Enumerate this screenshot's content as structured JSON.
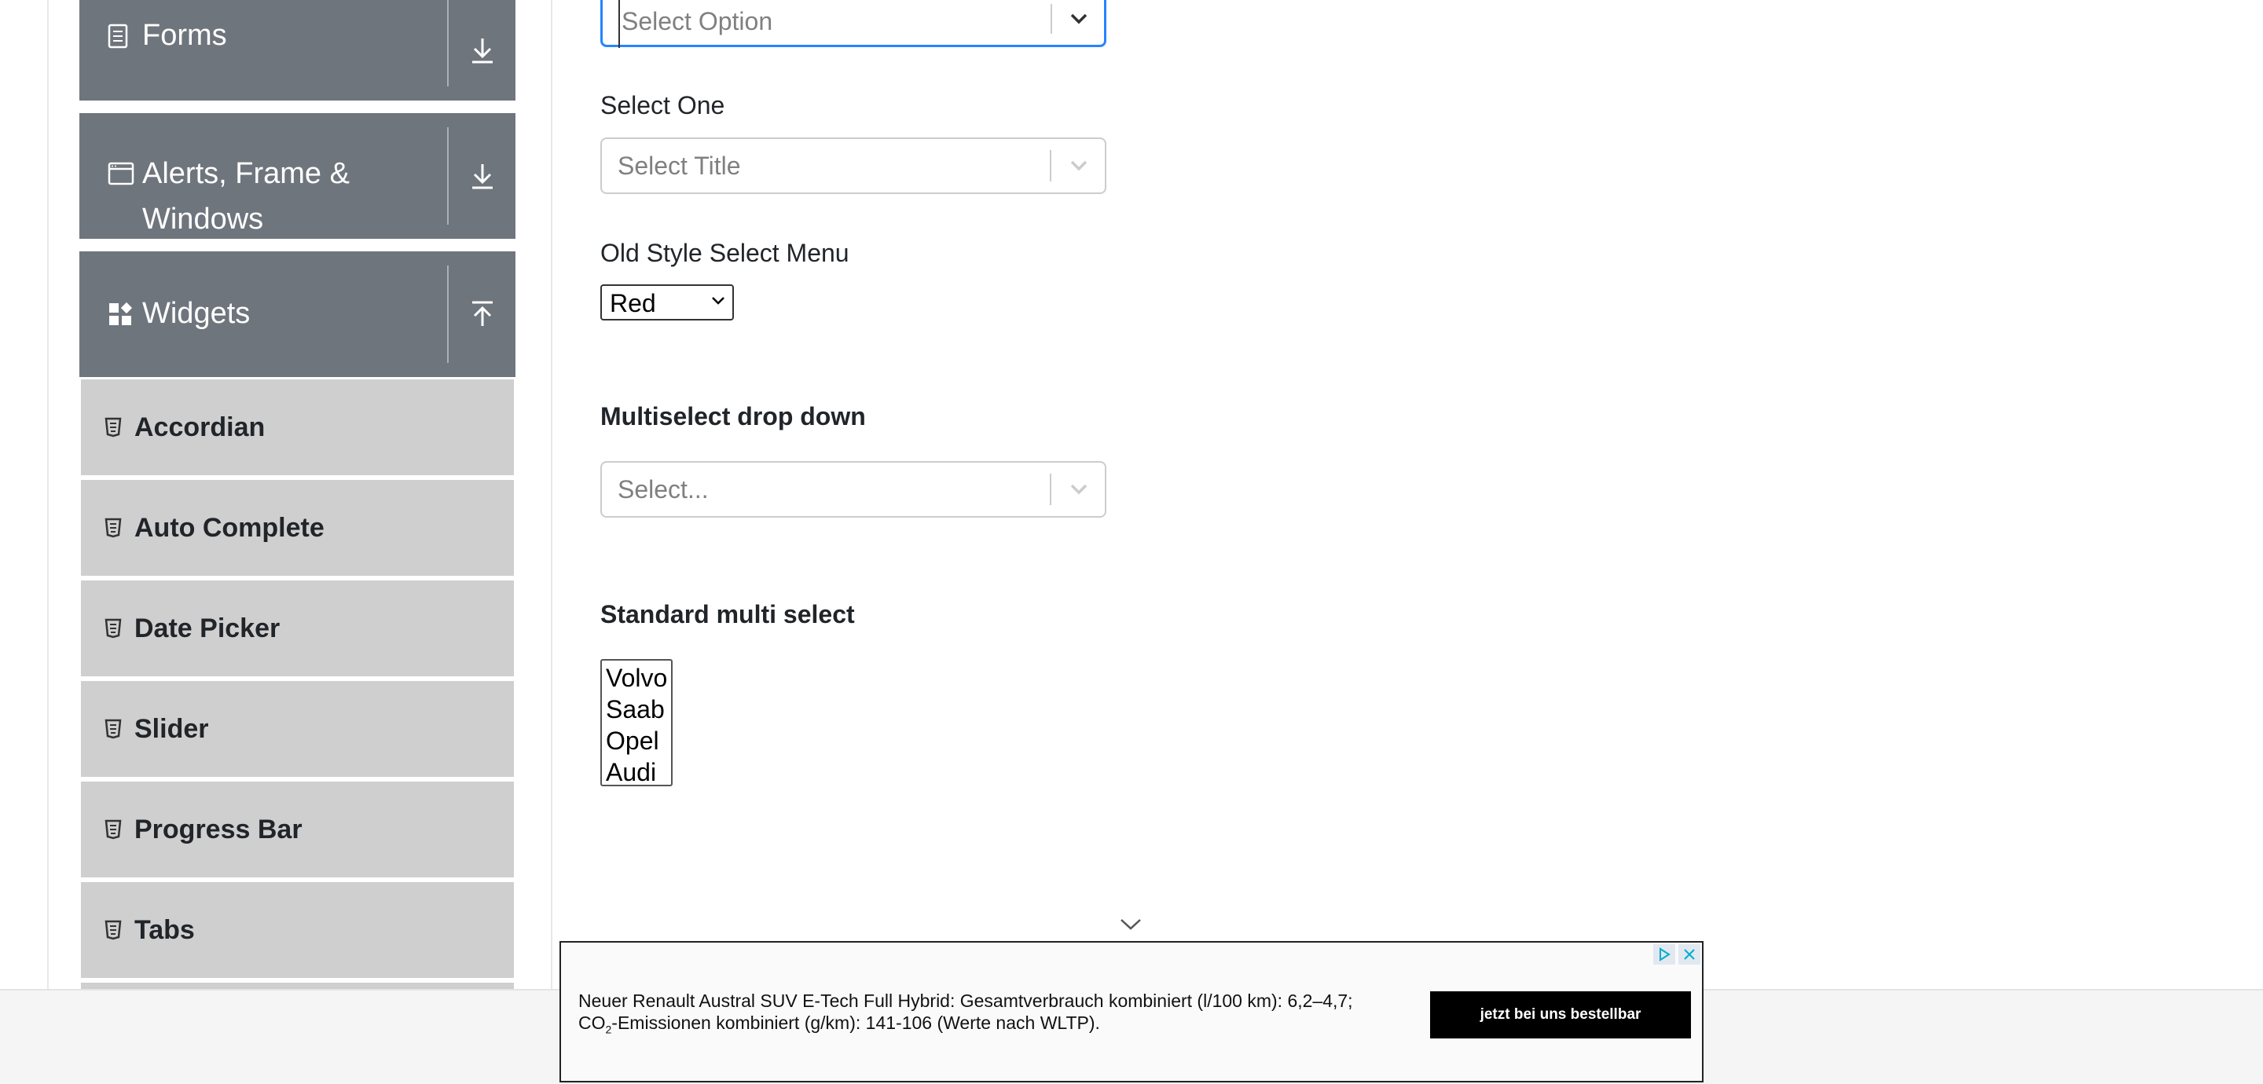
{
  "sidebar": {
    "groups": [
      {
        "title": "Forms",
        "icon": "document-icon",
        "toggle_icon": "download-arrow-icon"
      },
      {
        "title_line1": "Alerts, Frame &",
        "title_line2": "Windows",
        "icon": "window-icon",
        "toggle_icon": "download-arrow-icon"
      },
      {
        "title": "Widgets",
        "icon": "widgets-icon",
        "toggle_icon": "upload-arrow-icon"
      }
    ],
    "items": [
      {
        "label": "Accordian",
        "icon": "html5-icon"
      },
      {
        "label": "Auto Complete",
        "icon": "html5-icon"
      },
      {
        "label": "Date Picker",
        "icon": "html5-icon"
      },
      {
        "label": "Slider",
        "icon": "html5-icon"
      },
      {
        "label": "Progress Bar",
        "icon": "html5-icon"
      },
      {
        "label": "Tabs",
        "icon": "html5-icon"
      }
    ]
  },
  "form": {
    "select_value": {
      "placeholder": "Select Option"
    },
    "select_one": {
      "label": "Select One",
      "placeholder": "Select Title"
    },
    "old_style": {
      "label": "Old Style Select Menu",
      "selected": "Red"
    },
    "multiselect": {
      "label": "Multiselect drop down",
      "placeholder": "Select..."
    },
    "standard_multi": {
      "label": "Standard multi select",
      "options": [
        "Volvo",
        "Saab",
        "Opel",
        "Audi"
      ]
    }
  },
  "ad": {
    "text_part1": "Neuer Renault Austral SUV E-Tech Full Hybrid: Gesamtverbrauch kombiniert (l/100 km): 6,2–4,7; CO",
    "text_sub": "2",
    "text_part2": "-Emissionen kombiniert (g/km): 141-106 (Werte nach WLTP).",
    "cta": "jetzt bei uns bestellbar"
  },
  "colors": {
    "sidebar_group_bg": "#6f757d",
    "sidebar_item_bg": "#cfcfcf",
    "focus_border": "#2684ff"
  }
}
